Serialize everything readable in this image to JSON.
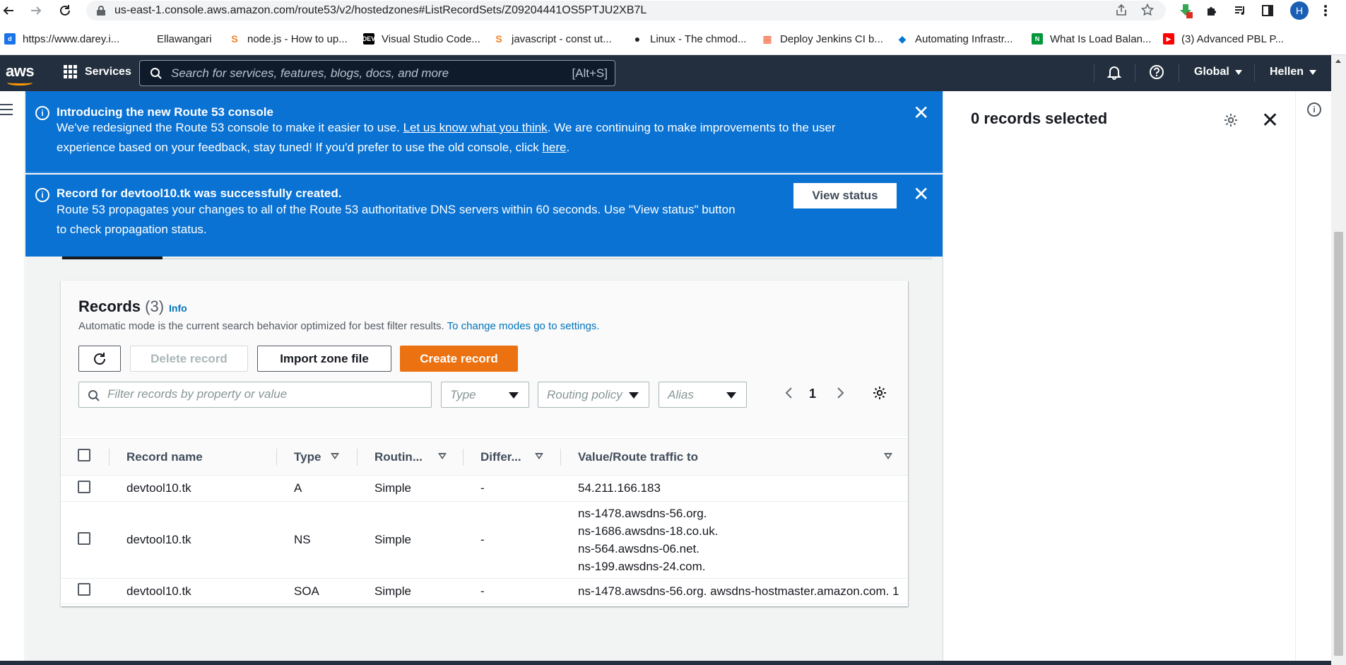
{
  "browser": {
    "url": "us-east-1.console.aws.amazon.com/route53/v2/hostedzones#ListRecordSets/Z09204441OS5PTJU2XB7L",
    "avatar_initial": "H",
    "bookmarks": [
      {
        "label": "https://www.darey.i...",
        "color": "#1a73e8",
        "glyph": "d"
      },
      {
        "label": "Ellawangari",
        "color": "#ffffff",
        "glyph": ""
      },
      {
        "label": "node.js - How to up...",
        "color": "#f48024",
        "glyph": "S"
      },
      {
        "label": "Visual Studio Code...",
        "color": "#000000",
        "glyph": "DEV"
      },
      {
        "label": "javascript - const ut...",
        "color": "#f48024",
        "glyph": "S"
      },
      {
        "label": "Linux - The chmod...",
        "color": "#202124",
        "glyph": "●"
      },
      {
        "label": "Deploy Jenkins CI b...",
        "color": "#f35325",
        "glyph": "▦"
      },
      {
        "label": "Automating Infrastr...",
        "color": "#0078d4",
        "glyph": "◆"
      },
      {
        "label": "What Is Load Balan...",
        "color": "#009639",
        "glyph": "N"
      },
      {
        "label": "(3) Advanced PBL P...",
        "color": "#ff0000",
        "glyph": "▶"
      }
    ]
  },
  "aws_nav": {
    "logo": "aws",
    "services_label": "Services",
    "search_placeholder": "Search for services, features, blogs, docs, and more",
    "search_shortcut": "[Alt+S]",
    "region_label": "Global",
    "user_label": "Hellen"
  },
  "flash_console": {
    "title": "Introducing the new Route 53 console",
    "body_part1": "We've redesigned the Route 53 console to make it easier to use. ",
    "link1": "Let us know what you think",
    "body_part2": ". We are continuing to make improvements to the user",
    "body_line2": "experience based on your feedback, stay tuned! If you'd prefer to use the old console, click ",
    "link2": "here",
    "body_end": "."
  },
  "flash_success": {
    "title": "Record for devtool10.tk was successfully created.",
    "body_line1": "Route 53 propagates your changes to all of the Route 53 authoritative DNS servers within 60 seconds. Use \"View status\" button",
    "body_line2": "to check propagation status.",
    "button_label": "View status"
  },
  "records": {
    "title": "Records",
    "count": "(3)",
    "info_label": "Info",
    "description": "Automatic mode is the current search behavior optimized for best filter results. ",
    "description_link": "To change modes go to settings.",
    "delete_label": "Delete record",
    "import_label": "Import zone file",
    "create_label": "Create record",
    "filter_placeholder": "Filter records by property or value",
    "type_placeholder": "Type",
    "routing_placeholder": "Routing policy",
    "alias_placeholder": "Alias",
    "page_number": "1",
    "columns": [
      "Record name",
      "Type",
      "Routin...",
      "Differ...",
      "Value/Route traffic to"
    ],
    "rows": [
      {
        "name": "devtool10.tk",
        "type": "A",
        "routing": "Simple",
        "differ": "-",
        "values": [
          "54.211.166.183"
        ]
      },
      {
        "name": "devtool10.tk",
        "type": "NS",
        "routing": "Simple",
        "differ": "-",
        "values": [
          "ns-1478.awsdns-56.org.",
          "ns-1686.awsdns-18.co.uk.",
          "ns-564.awsdns-06.net.",
          "ns-199.awsdns-24.com."
        ]
      },
      {
        "name": "devtool10.tk",
        "type": "SOA",
        "routing": "Simple",
        "differ": "-",
        "values": [
          "ns-1478.awsdns-56.org. awsdns-hostmaster.amazon.com. 1"
        ]
      }
    ]
  },
  "side_panel": {
    "title": "0 records selected"
  },
  "colors": {
    "aws_nav": "#232f3e",
    "flash_blue": "#0972d3",
    "primary_orange": "#ec7211",
    "link_blue": "#0073bb"
  }
}
